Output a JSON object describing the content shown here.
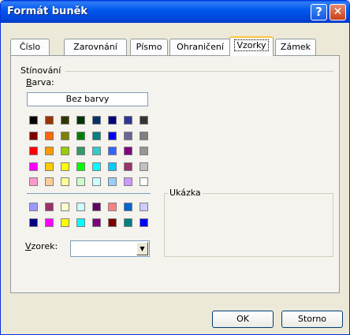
{
  "window": {
    "title": "Formát buněk",
    "help_glyph": "?",
    "close_glyph": "✕"
  },
  "tabs": [
    {
      "label": "Číslo",
      "active": false
    },
    {
      "label": "Zarovnání",
      "active": false
    },
    {
      "label": "Písmo",
      "active": false
    },
    {
      "label": "Ohraničení",
      "active": false
    },
    {
      "label": "Vzorky",
      "active": true
    },
    {
      "label": "Zámek",
      "active": false
    }
  ],
  "shading": {
    "group_label": "Stínování",
    "color_label_underlined": "B",
    "color_label_rest": "arva:",
    "no_color_button": "Bez barvy",
    "palette_rows": [
      [
        "#000000",
        "#993300",
        "#333300",
        "#003300",
        "#003366",
        "#000080",
        "#333399",
        "#333333"
      ],
      [
        "#800000",
        "#ff6600",
        "#808000",
        "#008000",
        "#008080",
        "#0000ff",
        "#666699",
        "#808080"
      ],
      [
        "#ff0000",
        "#ff9900",
        "#99cc00",
        "#339966",
        "#33cccc",
        "#3366ff",
        "#800080",
        "#969696"
      ],
      [
        "#ff00ff",
        "#ffcc00",
        "#ffff00",
        "#00ff00",
        "#00ffff",
        "#00ccff",
        "#993366",
        "#c0c0c0"
      ],
      [
        "#ff99cc",
        "#ffcc99",
        "#ffff99",
        "#ccffcc",
        "#ccffff",
        "#99ccff",
        "#cc99ff",
        "#ffffff"
      ]
    ],
    "extra_rows": [
      [
        "#9999ff",
        "#993366",
        "#ffffcc",
        "#ccffff",
        "#660066",
        "#ff8080",
        "#0066cc",
        "#ccccff"
      ],
      [
        "#000080",
        "#ff00ff",
        "#ffff00",
        "#00ffff",
        "#800080",
        "#800000",
        "#008080",
        "#0000ff"
      ]
    ]
  },
  "pattern": {
    "label_underlined": "V",
    "label_rest": "zorek:",
    "value": "",
    "dropdown_glyph": "▼"
  },
  "preview": {
    "label": "Ukázka"
  },
  "buttons": {
    "ok": "OK",
    "cancel": "Storno"
  }
}
